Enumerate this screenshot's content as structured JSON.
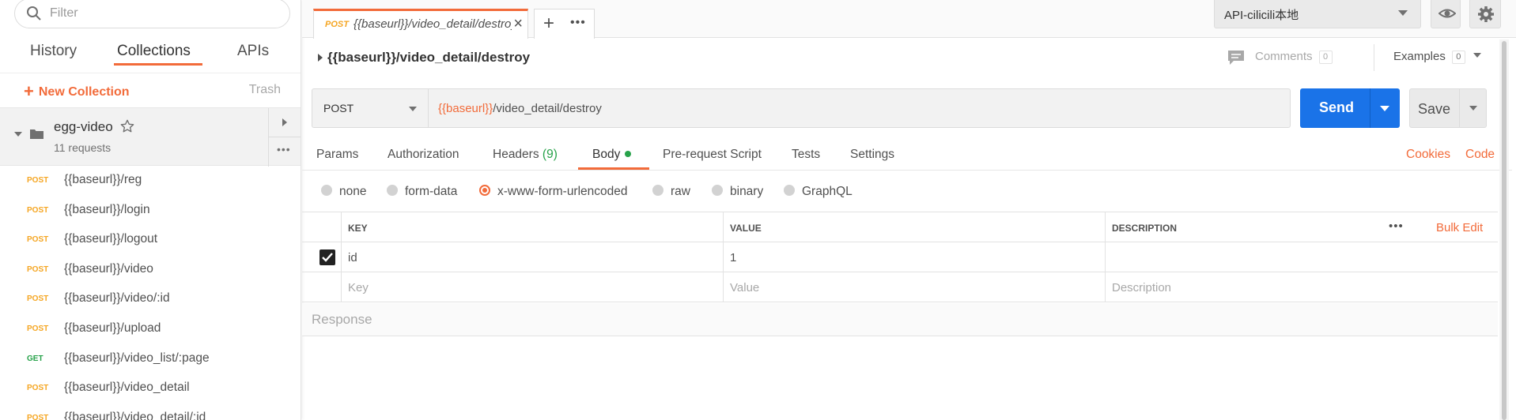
{
  "sidebar": {
    "filter_placeholder": "Filter",
    "tabs": [
      {
        "label": "History"
      },
      {
        "label": "Collections"
      },
      {
        "label": "APIs"
      }
    ],
    "new_collection": "New Collection",
    "trash": "Trash",
    "collection": {
      "name": "egg-video",
      "count": "11 requests"
    },
    "requests": [
      {
        "method": "POST",
        "url": "{{baseurl}}/reg"
      },
      {
        "method": "POST",
        "url": "{{baseurl}}/login"
      },
      {
        "method": "POST",
        "url": "{{baseurl}}/logout"
      },
      {
        "method": "POST",
        "url": "{{baseurl}}/video"
      },
      {
        "method": "POST",
        "url": "{{baseurl}}/video/:id"
      },
      {
        "method": "POST",
        "url": "{{baseurl}}/upload"
      },
      {
        "method": "GET",
        "url": "{{baseurl}}/video_list/:page"
      },
      {
        "method": "POST",
        "url": "{{baseurl}}/video_detail"
      },
      {
        "method": "POST",
        "url": "{{baseurl}}/video_detail/:id"
      }
    ]
  },
  "tab": {
    "method": "POST",
    "title": "{{baseurl}}/video_detail/destroy"
  },
  "environment": "API-cilicili本地",
  "request": {
    "title": "{{baseurl}}/video_detail/destroy",
    "comments_label": "Comments",
    "comments_count": "0",
    "examples_label": "Examples",
    "examples_count": "0",
    "method": "POST",
    "url_var": "{{baseurl}}",
    "url_path": "/video_detail/destroy",
    "send": "Send",
    "save": "Save"
  },
  "req_tabs": {
    "params": "Params",
    "authorization": "Authorization",
    "headers": "Headers",
    "headers_count": "(9)",
    "body": "Body",
    "prerequest": "Pre-request Script",
    "tests": "Tests",
    "settings": "Settings",
    "cookies": "Cookies",
    "code": "Code"
  },
  "body_types": {
    "none": "none",
    "form_data": "form-data",
    "urlencoded": "x-www-form-urlencoded",
    "raw": "raw",
    "binary": "binary",
    "graphql": "GraphQL",
    "selected": "x-www-form-urlencoded"
  },
  "kv_table": {
    "headers": {
      "key": "KEY",
      "value": "VALUE",
      "description": "DESCRIPTION"
    },
    "bulk_edit": "Bulk Edit",
    "rows": [
      {
        "key": "id",
        "value": "1",
        "description": "",
        "checked": true
      }
    ],
    "placeholders": {
      "key": "Key",
      "value": "Value",
      "description": "Description"
    }
  },
  "response": {
    "label": "Response"
  },
  "colors": {
    "accent": "#f26b3a",
    "send": "#1a73e8",
    "post": "#f5a623",
    "get": "#27a24a"
  }
}
